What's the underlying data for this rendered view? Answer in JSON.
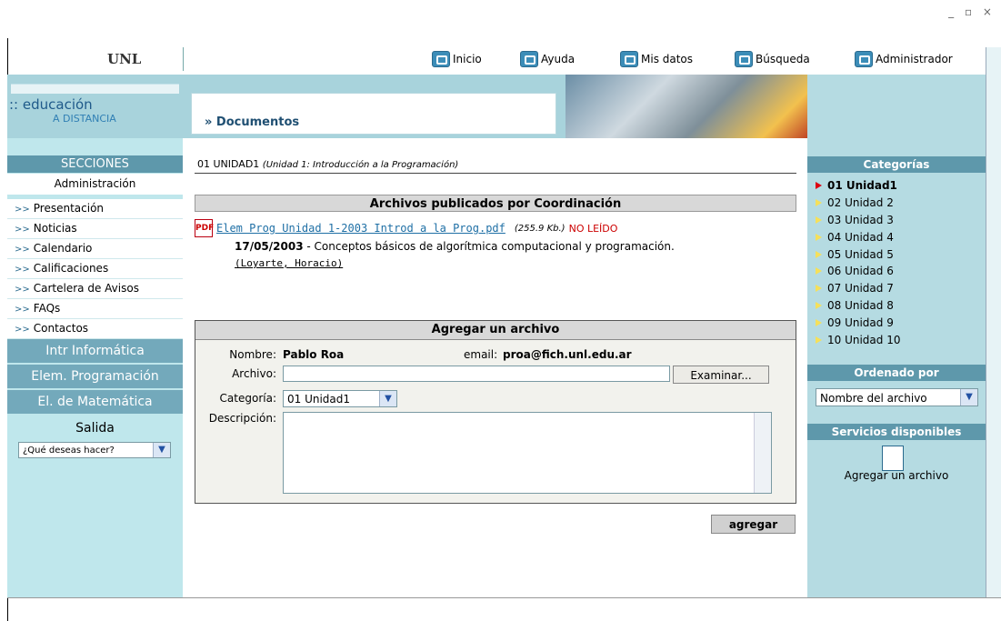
{
  "window": {
    "controls": "_ ▫ ×"
  },
  "brand": {
    "logo": "UNL",
    "edu_line1": ":: educación",
    "edu_line2": "A DISTANCIA"
  },
  "topnav": [
    {
      "label": "Inicio",
      "icon": "home-icon"
    },
    {
      "label": "Ayuda",
      "icon": "help-icon"
    },
    {
      "label": "Mis datos",
      "icon": "user-data-icon"
    },
    {
      "label": "Búsqueda",
      "icon": "search-icon"
    },
    {
      "label": "Administrador",
      "icon": "admin-icon"
    }
  ],
  "section_title": "» Documentos",
  "sidebar": {
    "header": "SECCIONES",
    "admin": "Administración",
    "items": [
      "Presentación",
      "Noticias",
      "Calendario",
      "Calificaciones",
      "Cartelera de Avisos",
      "FAQs",
      "Contactos"
    ],
    "blocks": [
      "Intr Informática",
      "Elem. Programación",
      "El. de Matemática"
    ],
    "salida": "Salida",
    "select": "¿Qué deseas hacer?"
  },
  "main": {
    "path_prefix": "01 UNIDAD1",
    "path_detail": "(Unidad 1: Introducción a la Programación)",
    "published_title": "Archivos publicados por Coordinación",
    "file": {
      "name": "Elem Prog Unidad 1-2003 Introd a la Prog.pdf",
      "size": "(255.9 Kb.)",
      "status": "NO LEÍDO",
      "date": "17/05/2003",
      "description": " - Conceptos básicos de algorítmica computacional y programación.",
      "author": "(Loyarte, Horacio)"
    },
    "add_form": {
      "title": "Agregar un archivo",
      "nombre_label": "Nombre:",
      "nombre_value": "Pablo Roa",
      "email_label": "email:",
      "email_value": "proa@fich.unl.edu.ar",
      "archivo_label": "Archivo:",
      "archivo_value": "",
      "examinar": "Examinar...",
      "categoria_label": "Categoría:",
      "categoria_value": "01 Unidad1",
      "descripcion_label": "Descripción:",
      "descripcion_value": "",
      "submit": "agregar"
    }
  },
  "right": {
    "categorias_header": "Categorías",
    "categorias": [
      "01 Unidad1",
      "02 Unidad 2",
      "03 Unidad 3",
      "04 Unidad 4",
      "05 Unidad 5",
      "06 Unidad 6",
      "07 Unidad 7",
      "08 Unidad 8",
      "09 Unidad 9",
      "10 Unidad 10"
    ],
    "selected_index": 0,
    "ordenado_header": "Ordenado por",
    "ordenado_value": "Nombre del archivo",
    "servicios_header": "Servicios disponibles",
    "servicio": "Agregar un archivo"
  }
}
